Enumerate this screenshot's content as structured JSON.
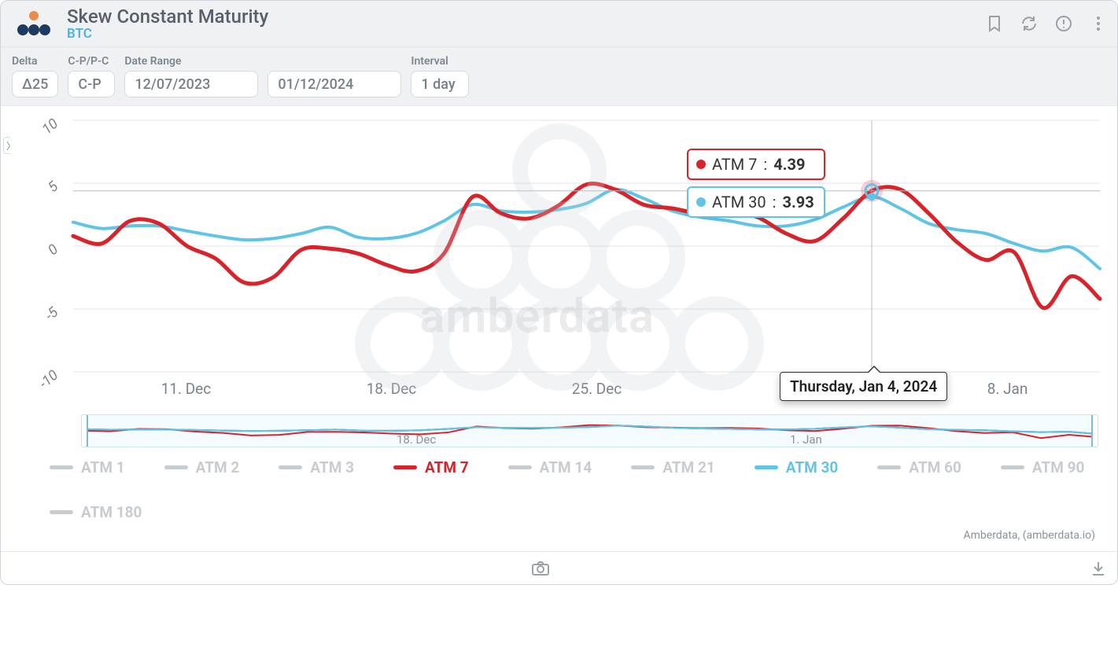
{
  "header": {
    "title": "Skew Constant Maturity",
    "subtitle": "BTC"
  },
  "controls": {
    "delta": {
      "label": "Delta",
      "value": "Δ25"
    },
    "cp": {
      "label": "C-P/P-C",
      "value": "C-P"
    },
    "range": {
      "label": "Date Range",
      "start": "12/07/2023",
      "end": "01/12/2024"
    },
    "interval": {
      "label": "Interval",
      "value": "1 day"
    }
  },
  "tooltip": {
    "date": "Thursday, Jan 4, 2024",
    "atm7": {
      "label": "ATM 7",
      "value": "4.39"
    },
    "atm30": {
      "label": "ATM 30",
      "value": "3.93"
    }
  },
  "legend": {
    "items": [
      {
        "label": "ATM 1",
        "active": false
      },
      {
        "label": "ATM 2",
        "active": false
      },
      {
        "label": "ATM 3",
        "active": false
      },
      {
        "label": "ATM 7",
        "active": true,
        "color": "#d8232a"
      },
      {
        "label": "ATM 14",
        "active": false
      },
      {
        "label": "ATM 21",
        "active": false
      },
      {
        "label": "ATM 30",
        "active": true,
        "color": "#5fc4e6"
      },
      {
        "label": "ATM 60",
        "active": false
      },
      {
        "label": "ATM 90",
        "active": false
      },
      {
        "label": "ATM 180",
        "active": false
      }
    ]
  },
  "navigator": {
    "ticks": [
      "18. Dec",
      "1. Jan"
    ]
  },
  "credits": "Amberdata, (amberdata.io)",
  "watermark": "amberdata",
  "chart_data": {
    "type": "line",
    "xlabel": "",
    "ylabel": "",
    "ylim": [
      -10,
      10
    ],
    "x_ticks": [
      "11. Dec",
      "18. Dec",
      "25. Dec",
      "1. Jan",
      "8. Jan"
    ],
    "x": [
      "2023-12-07",
      "2023-12-08",
      "2023-12-09",
      "2023-12-10",
      "2023-12-11",
      "2023-12-12",
      "2023-12-13",
      "2023-12-14",
      "2023-12-15",
      "2023-12-16",
      "2023-12-17",
      "2023-12-18",
      "2023-12-19",
      "2023-12-20",
      "2023-12-21",
      "2023-12-22",
      "2023-12-23",
      "2023-12-24",
      "2023-12-25",
      "2023-12-26",
      "2023-12-27",
      "2023-12-28",
      "2023-12-29",
      "2023-12-30",
      "2023-12-31",
      "2024-01-01",
      "2024-01-02",
      "2024-01-03",
      "2024-01-04",
      "2024-01-05",
      "2024-01-06",
      "2024-01-07",
      "2024-01-08",
      "2024-01-09",
      "2024-01-10",
      "2024-01-11",
      "2024-01-12"
    ],
    "series": [
      {
        "name": "ATM 7",
        "color": "#d8232a",
        "values": [
          0.8,
          0.2,
          2.0,
          1.8,
          0.0,
          -1.0,
          -2.9,
          -2.5,
          -0.3,
          -0.2,
          -0.6,
          -1.5,
          -2.0,
          -0.6,
          3.9,
          2.6,
          2.2,
          3.2,
          4.9,
          4.5,
          3.3,
          3.0,
          2.6,
          2.8,
          2.3,
          1.0,
          0.4,
          2.2,
          4.39,
          4.5,
          2.6,
          0.3,
          -1.1,
          -0.5,
          -4.9,
          -2.4,
          -4.2
        ]
      },
      {
        "name": "ATM 30",
        "color": "#5fc4e6",
        "values": [
          1.9,
          1.4,
          1.6,
          1.6,
          1.2,
          0.8,
          0.5,
          0.6,
          1.0,
          1.5,
          0.7,
          0.6,
          1.0,
          2.0,
          3.3,
          2.8,
          2.7,
          2.9,
          3.4,
          4.5,
          3.8,
          2.8,
          2.3,
          2.0,
          1.6,
          1.6,
          2.1,
          3.1,
          3.93,
          3.0,
          1.8,
          1.3,
          1.0,
          0.2,
          -0.4,
          -0.1,
          -1.8
        ]
      }
    ],
    "crosshair_x": "2024-01-04"
  }
}
